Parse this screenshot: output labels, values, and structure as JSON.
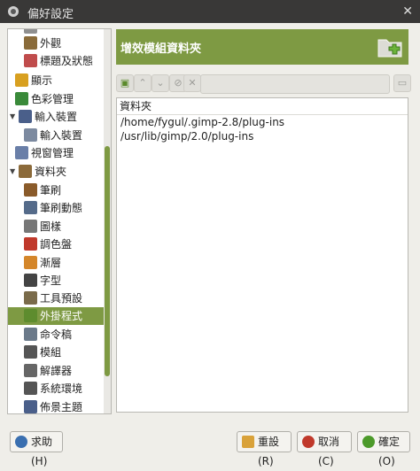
{
  "window": {
    "title": "偏好設定"
  },
  "sidebar": {
    "items": [
      {
        "label": "外觀",
        "icon": "appearance-icon",
        "color": "#8a6b3a"
      },
      {
        "label": "標題及狀態",
        "icon": "title-status-icon",
        "color": "#c04c4c"
      },
      {
        "label": "顯示",
        "icon": "display-icon",
        "color": "#d8a020"
      },
      {
        "label": "色彩管理",
        "icon": "color-management-icon",
        "color": "#3a8a3a"
      },
      {
        "label": "輸入裝置",
        "icon": "input-devices-icon",
        "color": "#4a5f8a"
      },
      {
        "label": "輸入裝置",
        "icon": "input-device-icon",
        "color": "#7c8aa0"
      },
      {
        "label": "視窗管理",
        "icon": "window-management-icon",
        "color": "#6a7fa8"
      },
      {
        "label": "資料夾",
        "icon": "folders-icon",
        "color": "#8b6a3a"
      },
      {
        "label": "筆刷",
        "icon": "brush-icon",
        "color": "#8a5b2a"
      },
      {
        "label": "筆刷動態",
        "icon": "dynamics-icon",
        "color": "#556b8a"
      },
      {
        "label": "圖樣",
        "icon": "pattern-icon",
        "color": "#777777"
      },
      {
        "label": "調色盤",
        "icon": "palette-icon",
        "color": "#c0392b"
      },
      {
        "label": "漸層",
        "icon": "gradient-icon",
        "color": "#d4862a"
      },
      {
        "label": "字型",
        "icon": "font-icon",
        "color": "#444444"
      },
      {
        "label": "工具預設",
        "icon": "tool-presets-icon",
        "color": "#7a6b4a"
      },
      {
        "label": "外掛程式",
        "icon": "plugin-icon",
        "color": "#5e8c2e"
      },
      {
        "label": "命令稿",
        "icon": "script-icon",
        "color": "#6b7a8a"
      },
      {
        "label": "模組",
        "icon": "modules-icon",
        "color": "#555555"
      },
      {
        "label": "解譯器",
        "icon": "interpreters-icon",
        "color": "#666666"
      },
      {
        "label": "系統環境",
        "icon": "environment-icon",
        "color": "#555555"
      },
      {
        "label": "佈景主題",
        "icon": "themes-icon",
        "color": "#4a5f8a"
      }
    ]
  },
  "header": {
    "title": "增效模組資料夾",
    "icon": "plugin-folder-icon"
  },
  "toolbar": {
    "buttons": [
      "add-folder-icon",
      "move-up-icon",
      "move-down-icon",
      "delete-icon",
      "clear-icon",
      "browse-icon"
    ],
    "path_value": ""
  },
  "list": {
    "column_header": "資料夾",
    "rows": [
      "/home/fygul/.gimp-2.8/plug-ins",
      "/usr/lib/gimp/2.0/plug-ins"
    ]
  },
  "buttons": {
    "help": "求助(H)",
    "reset": "重設(R)",
    "cancel": "取消(C)",
    "ok": "確定(O)"
  },
  "colors": {
    "accent": "#7e9a43",
    "titlebar": "#393837"
  }
}
